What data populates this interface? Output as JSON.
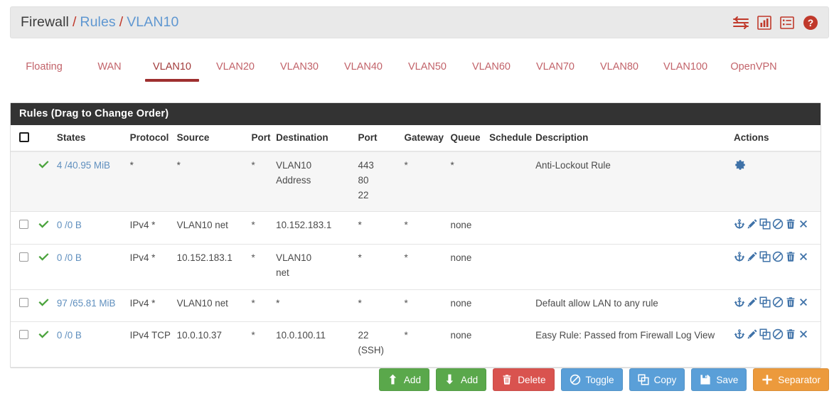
{
  "breadcrumb": {
    "root": "Firewall",
    "sep": "/",
    "level2": "Rules",
    "level3": "VLAN10"
  },
  "header_icons": [
    {
      "name": "sliders-icon",
      "color": "#c0392b"
    },
    {
      "name": "bar-chart-icon",
      "color": "#c0392b"
    },
    {
      "name": "list-icon",
      "color": "#c0392b"
    },
    {
      "name": "help-circle-icon",
      "color": "#c0392b"
    }
  ],
  "tabs": [
    {
      "label": "Floating",
      "active": false
    },
    {
      "label": "WAN",
      "active": false
    },
    {
      "label": "VLAN10",
      "active": true
    },
    {
      "label": "VLAN20",
      "active": false
    },
    {
      "label": "VLAN30",
      "active": false
    },
    {
      "label": "VLAN40",
      "active": false
    },
    {
      "label": "VLAN50",
      "active": false
    },
    {
      "label": "VLAN60",
      "active": false
    },
    {
      "label": "VLAN70",
      "active": false
    },
    {
      "label": "VLAN80",
      "active": false
    },
    {
      "label": "VLAN100",
      "active": false
    },
    {
      "label": "OpenVPN",
      "active": false
    }
  ],
  "panel": {
    "title": "Rules (Drag to Change Order)",
    "columns": {
      "checkbox": "",
      "states": "States",
      "protocol": "Protocol",
      "source": "Source",
      "source_port": "Port",
      "destination": "Destination",
      "dest_port": "Port",
      "gateway": "Gateway",
      "queue": "Queue",
      "schedule": "Schedule",
      "description": "Description",
      "actions": "Actions"
    },
    "rows": [
      {
        "has_checkbox": false,
        "shaded": true,
        "status": "pass",
        "states": "4 /40.95 MiB",
        "protocol": "*",
        "source": "*",
        "source_port": "*",
        "destination": "VLAN10 Address",
        "dest_port": "443 80 22",
        "dest_port_lines": [
          "443",
          "80",
          "22"
        ],
        "gateway": "*",
        "queue": "*",
        "schedule": "",
        "description": "Anti-Lockout Rule",
        "actions": [
          "gear-icon"
        ]
      },
      {
        "has_checkbox": true,
        "shaded": false,
        "status": "pass",
        "states": "0 /0 B",
        "protocol": "IPv4 *",
        "source": "VLAN10 net",
        "source_port": "*",
        "destination": "10.152.183.1",
        "dest_port": "*",
        "dest_port_lines": [
          "*"
        ],
        "gateway": "*",
        "queue": "none",
        "schedule": "",
        "description": "",
        "actions": [
          "anchor-icon",
          "pencil-icon",
          "copy-icon",
          "ban-icon",
          "trash-icon",
          "close-icon"
        ]
      },
      {
        "has_checkbox": true,
        "shaded": false,
        "status": "pass",
        "states": "0 /0 B",
        "protocol": "IPv4 *",
        "source": "10.152.183.1",
        "source_port": "*",
        "destination": "VLAN10 net",
        "dest_port": "*",
        "dest_port_lines": [
          "*"
        ],
        "gateway": "*",
        "queue": "none",
        "schedule": "",
        "description": "",
        "actions": [
          "anchor-icon",
          "pencil-icon",
          "copy-icon",
          "ban-icon",
          "trash-icon",
          "close-icon"
        ]
      },
      {
        "has_checkbox": true,
        "shaded": false,
        "status": "pass",
        "states": "97 /65.81 MiB",
        "protocol": "IPv4 *",
        "source": "VLAN10 net",
        "source_port": "*",
        "destination": "*",
        "dest_port": "*",
        "dest_port_lines": [
          "*"
        ],
        "gateway": "*",
        "queue": "none",
        "schedule": "",
        "description": "Default allow LAN to any rule",
        "actions": [
          "anchor-icon",
          "pencil-icon",
          "copy-icon",
          "ban-icon",
          "trash-icon",
          "close-icon"
        ]
      },
      {
        "has_checkbox": true,
        "shaded": false,
        "status": "pass",
        "states": "0 /0 B",
        "protocol": "IPv4 TCP",
        "source": "10.0.10.37",
        "source_port": "*",
        "destination": "10.0.100.11",
        "dest_port": "22 (SSH)",
        "dest_port_lines": [
          "22",
          "(SSH)"
        ],
        "gateway": "*",
        "queue": "none",
        "schedule": "",
        "description": "Easy Rule: Passed from Firewall Log View",
        "actions": [
          "anchor-icon",
          "pencil-icon",
          "copy-icon",
          "ban-icon",
          "trash-icon",
          "close-icon"
        ]
      }
    ]
  },
  "footer_buttons": [
    {
      "label": "Add",
      "icon": "arrow-up-icon",
      "style": "green"
    },
    {
      "label": "Add",
      "icon": "arrow-down-icon",
      "style": "green"
    },
    {
      "label": "Delete",
      "icon": "trash-icon",
      "style": "red"
    },
    {
      "label": "Toggle",
      "icon": "ban-icon",
      "style": "blue"
    },
    {
      "label": "Copy",
      "icon": "copy-icon",
      "style": "blue"
    },
    {
      "label": "Save",
      "icon": "save-icon",
      "style": "blue"
    },
    {
      "label": "Separator",
      "icon": "plus-icon",
      "style": "orange"
    }
  ],
  "colors": {
    "accent_red": "#c0392b",
    "tab_red": "#c2636a",
    "link_blue": "#5f8fbe",
    "icon_blue": "#3f72a8",
    "pass_green": "#4aa33c",
    "panel_head_bg": "#333333"
  }
}
